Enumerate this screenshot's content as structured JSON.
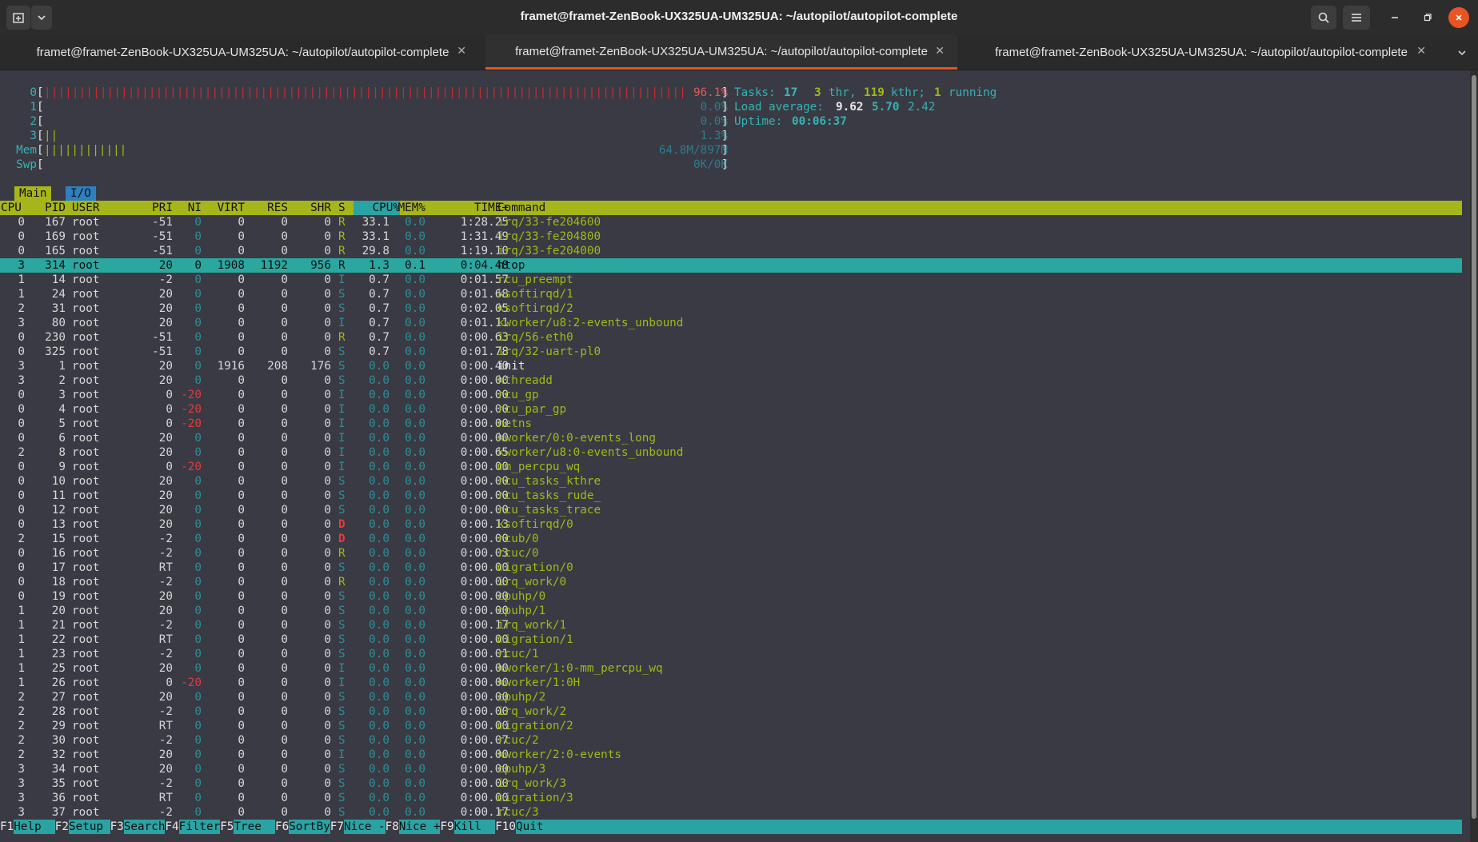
{
  "window": {
    "title": "framet@framet-ZenBook-UX325UA-UM325UA: ~/autopilot/autopilot-complete",
    "new_tab_icon": "new-tab-icon",
    "menu_icon": "chevron-down-icon"
  },
  "tabs": [
    {
      "label": "framet@framet-ZenBook-UX325UA-UM325UA: ~/autopilot/autopilot-complete",
      "active": false
    },
    {
      "label": "framet@framet-ZenBook-UX325UA-UM325UA: ~/autopilot/autopilot-complete",
      "active": true
    },
    {
      "label": "framet@framet-ZenBook-UX325UA-UM325UA: ~/autopilot/autopilot-complete",
      "active": false
    }
  ],
  "meters": {
    "cpu": [
      {
        "label": "0",
        "bars": "||||||||||||||||||||||||||||||||||||||||||||||||||||||||||||||||||||||||||||||||||||||||||||||||",
        "value": "96.1%"
      },
      {
        "label": "1",
        "bars": "",
        "value": "0.0%"
      },
      {
        "label": "2",
        "bars": "",
        "value": "0.0%"
      },
      {
        "label": "3",
        "bars": "||",
        "value": "1.3%"
      }
    ],
    "mem": {
      "label": "Mem",
      "bars": "||||||||||||",
      "value": "64.8M/897M"
    },
    "swp": {
      "label": "Swp",
      "bars": "",
      "value": "0K/0K"
    }
  },
  "summary": {
    "tasks_label": "Tasks:",
    "tasks": "17",
    "thr": "3",
    "thr_label": "thr,",
    "kthr": "119",
    "kthr_label": "kthr;",
    "running": "1",
    "running_label": "running",
    "load_label": "Load average:",
    "load1": "9.62",
    "load5": "5.70",
    "load15": "2.42",
    "uptime_label": "Uptime:",
    "uptime": "00:06:37"
  },
  "subtabs": {
    "main": "Main",
    "io": "I/O"
  },
  "columns": [
    "CPU",
    "PID",
    "USER",
    "PRI",
    "NI",
    "VIRT",
    "RES",
    "SHR",
    "S",
    "CPU%",
    "MEM%",
    "TIME+",
    "Command"
  ],
  "selected_pid": "314",
  "processes": [
    [
      "0",
      "167",
      "root",
      "-51",
      "0",
      "0",
      "0",
      "0",
      "R",
      "33.1",
      "0.0",
      "1:28.25",
      "irq/33-fe204600"
    ],
    [
      "0",
      "169",
      "root",
      "-51",
      "0",
      "0",
      "0",
      "0",
      "R",
      "33.1",
      "0.0",
      "1:31.49",
      "irq/33-fe204800"
    ],
    [
      "0",
      "165",
      "root",
      "-51",
      "0",
      "0",
      "0",
      "0",
      "R",
      "29.8",
      "0.0",
      "1:19.10",
      "irq/33-fe204000"
    ],
    [
      "3",
      "314",
      "root",
      "20",
      "0",
      "1908",
      "1192",
      "956",
      "R",
      "1.3",
      "0.1",
      "0:04.48",
      "htop"
    ],
    [
      "1",
      "14",
      "root",
      "-2",
      "0",
      "0",
      "0",
      "0",
      "I",
      "0.7",
      "0.0",
      "0:01.57",
      "rcu_preempt"
    ],
    [
      "1",
      "24",
      "root",
      "20",
      "0",
      "0",
      "0",
      "0",
      "S",
      "0.7",
      "0.0",
      "0:01.68",
      "ksoftirqd/1"
    ],
    [
      "2",
      "31",
      "root",
      "20",
      "0",
      "0",
      "0",
      "0",
      "S",
      "0.7",
      "0.0",
      "0:02.05",
      "ksoftirqd/2"
    ],
    [
      "3",
      "80",
      "root",
      "20",
      "0",
      "0",
      "0",
      "0",
      "I",
      "0.7",
      "0.0",
      "0:01.11",
      "kworker/u8:2-events_unbound"
    ],
    [
      "0",
      "230",
      "root",
      "-51",
      "0",
      "0",
      "0",
      "0",
      "R",
      "0.7",
      "0.0",
      "0:00.63",
      "irq/56-eth0"
    ],
    [
      "0",
      "325",
      "root",
      "-51",
      "0",
      "0",
      "0",
      "0",
      "S",
      "0.7",
      "0.0",
      "0:01.78",
      "irq/32-uart-pl0"
    ],
    [
      "3",
      "1",
      "root",
      "20",
      "0",
      "1916",
      "208",
      "176",
      "S",
      "0.0",
      "0.0",
      "0:00.40",
      "init"
    ],
    [
      "3",
      "2",
      "root",
      "20",
      "0",
      "0",
      "0",
      "0",
      "S",
      "0.0",
      "0.0",
      "0:00.00",
      "kthreadd"
    ],
    [
      "0",
      "3",
      "root",
      "0",
      "-20",
      "0",
      "0",
      "0",
      "I",
      "0.0",
      "0.0",
      "0:00.00",
      "rcu_gp"
    ],
    [
      "0",
      "4",
      "root",
      "0",
      "-20",
      "0",
      "0",
      "0",
      "I",
      "0.0",
      "0.0",
      "0:00.00",
      "rcu_par_gp"
    ],
    [
      "0",
      "5",
      "root",
      "0",
      "-20",
      "0",
      "0",
      "0",
      "I",
      "0.0",
      "0.0",
      "0:00.00",
      "netns"
    ],
    [
      "0",
      "6",
      "root",
      "20",
      "0",
      "0",
      "0",
      "0",
      "I",
      "0.0",
      "0.0",
      "0:00.00",
      "kworker/0:0-events_long"
    ],
    [
      "2",
      "8",
      "root",
      "20",
      "0",
      "0",
      "0",
      "0",
      "I",
      "0.0",
      "0.0",
      "0:00.65",
      "kworker/u8:0-events_unbound"
    ],
    [
      "0",
      "9",
      "root",
      "0",
      "-20",
      "0",
      "0",
      "0",
      "I",
      "0.0",
      "0.0",
      "0:00.00",
      "mm_percpu_wq"
    ],
    [
      "0",
      "10",
      "root",
      "20",
      "0",
      "0",
      "0",
      "0",
      "S",
      "0.0",
      "0.0",
      "0:00.00",
      "rcu_tasks_kthre"
    ],
    [
      "0",
      "11",
      "root",
      "20",
      "0",
      "0",
      "0",
      "0",
      "S",
      "0.0",
      "0.0",
      "0:00.00",
      "rcu_tasks_rude_"
    ],
    [
      "0",
      "12",
      "root",
      "20",
      "0",
      "0",
      "0",
      "0",
      "S",
      "0.0",
      "0.0",
      "0:00.00",
      "rcu_tasks_trace"
    ],
    [
      "0",
      "13",
      "root",
      "20",
      "0",
      "0",
      "0",
      "0",
      "D",
      "0.0",
      "0.0",
      "0:00.13",
      "ksoftirqd/0"
    ],
    [
      "2",
      "15",
      "root",
      "-2",
      "0",
      "0",
      "0",
      "0",
      "D",
      "0.0",
      "0.0",
      "0:00.00",
      "rcub/0"
    ],
    [
      "0",
      "16",
      "root",
      "-2",
      "0",
      "0",
      "0",
      "0",
      "R",
      "0.0",
      "0.0",
      "0:00.03",
      "rcuc/0"
    ],
    [
      "0",
      "17",
      "root",
      "RT",
      "0",
      "0",
      "0",
      "0",
      "S",
      "0.0",
      "0.0",
      "0:00.00",
      "migration/0"
    ],
    [
      "0",
      "18",
      "root",
      "-2",
      "0",
      "0",
      "0",
      "0",
      "R",
      "0.0",
      "0.0",
      "0:00.00",
      "irq_work/0"
    ],
    [
      "0",
      "19",
      "root",
      "20",
      "0",
      "0",
      "0",
      "0",
      "S",
      "0.0",
      "0.0",
      "0:00.00",
      "cpuhp/0"
    ],
    [
      "1",
      "20",
      "root",
      "20",
      "0",
      "0",
      "0",
      "0",
      "S",
      "0.0",
      "0.0",
      "0:00.00",
      "cpuhp/1"
    ],
    [
      "1",
      "21",
      "root",
      "-2",
      "0",
      "0",
      "0",
      "0",
      "S",
      "0.0",
      "0.0",
      "0:00.17",
      "irq_work/1"
    ],
    [
      "1",
      "22",
      "root",
      "RT",
      "0",
      "0",
      "0",
      "0",
      "S",
      "0.0",
      "0.0",
      "0:00.00",
      "migration/1"
    ],
    [
      "1",
      "23",
      "root",
      "-2",
      "0",
      "0",
      "0",
      "0",
      "S",
      "0.0",
      "0.0",
      "0:00.01",
      "rcuc/1"
    ],
    [
      "1",
      "25",
      "root",
      "20",
      "0",
      "0",
      "0",
      "0",
      "I",
      "0.0",
      "0.0",
      "0:00.00",
      "kworker/1:0-mm_percpu_wq"
    ],
    [
      "1",
      "26",
      "root",
      "0",
      "-20",
      "0",
      "0",
      "0",
      "I",
      "0.0",
      "0.0",
      "0:00.00",
      "kworker/1:0H"
    ],
    [
      "2",
      "27",
      "root",
      "20",
      "0",
      "0",
      "0",
      "0",
      "S",
      "0.0",
      "0.0",
      "0:00.00",
      "cpuhp/2"
    ],
    [
      "2",
      "28",
      "root",
      "-2",
      "0",
      "0",
      "0",
      "0",
      "S",
      "0.0",
      "0.0",
      "0:00.00",
      "irq_work/2"
    ],
    [
      "2",
      "29",
      "root",
      "RT",
      "0",
      "0",
      "0",
      "0",
      "S",
      "0.0",
      "0.0",
      "0:00.00",
      "migration/2"
    ],
    [
      "2",
      "30",
      "root",
      "-2",
      "0",
      "0",
      "0",
      "0",
      "S",
      "0.0",
      "0.0",
      "0:00.07",
      "rcuc/2"
    ],
    [
      "2",
      "32",
      "root",
      "20",
      "0",
      "0",
      "0",
      "0",
      "I",
      "0.0",
      "0.0",
      "0:00.00",
      "kworker/2:0-events"
    ],
    [
      "3",
      "34",
      "root",
      "20",
      "0",
      "0",
      "0",
      "0",
      "S",
      "0.0",
      "0.0",
      "0:00.00",
      "cpuhp/3"
    ],
    [
      "3",
      "35",
      "root",
      "-2",
      "0",
      "0",
      "0",
      "0",
      "S",
      "0.0",
      "0.0",
      "0:00.00",
      "irq_work/3"
    ],
    [
      "3",
      "36",
      "root",
      "RT",
      "0",
      "0",
      "0",
      "0",
      "S",
      "0.0",
      "0.0",
      "0:00.00",
      "migration/3"
    ],
    [
      "3",
      "37",
      "root",
      "-2",
      "0",
      "0",
      "0",
      "0",
      "S",
      "0.0",
      "0.0",
      "0:00.17",
      "rcuc/3"
    ]
  ],
  "function_keys": [
    {
      "key": "F1",
      "label": "Help  "
    },
    {
      "key": "F2",
      "label": "Setup "
    },
    {
      "key": "F3",
      "label": "Search"
    },
    {
      "key": "F4",
      "label": "Filter"
    },
    {
      "key": "F5",
      "label": "Tree  "
    },
    {
      "key": "F6",
      "label": "SortBy"
    },
    {
      "key": "F7",
      "label": "Nice -"
    },
    {
      "key": "F8",
      "label": "Nice +"
    },
    {
      "key": "F9",
      "label": "Kill  "
    },
    {
      "key": "F10",
      "label": "Quit"
    }
  ],
  "colors": {
    "accent": "#e95420",
    "header_bg": "#a6b51a",
    "selected_bg": "#2aa79f",
    "terminal_bg": "#3a3a44"
  }
}
